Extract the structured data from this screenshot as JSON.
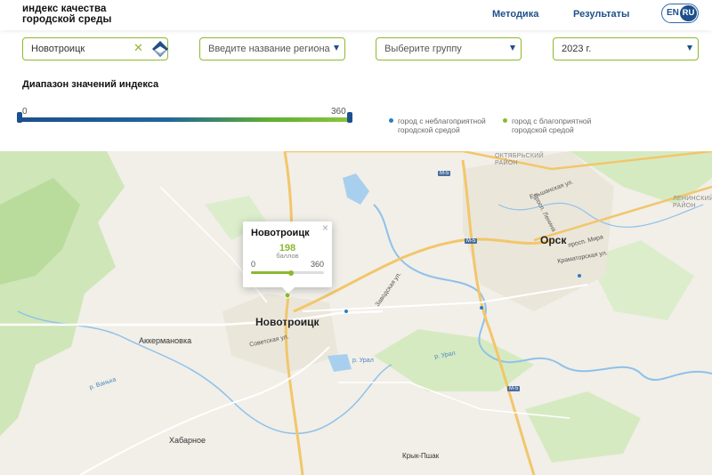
{
  "header": {
    "logo_line1": "индекс качества",
    "logo_line2": "городской среды",
    "nav": [
      "Методика",
      "Результаты"
    ],
    "lang_en": "EN",
    "lang_ru": "RU"
  },
  "filters": {
    "city": {
      "value": "Новотроицк"
    },
    "region": {
      "placeholder": "Введите название региона"
    },
    "group": {
      "placeholder": "Выберите группу"
    },
    "year": {
      "value": "2023 г."
    }
  },
  "range": {
    "title": "Диапазон значений индекса",
    "min": "0",
    "max": "360"
  },
  "legend": [
    {
      "line1": "город с неблагоприятной",
      "line2": "городской средой",
      "color": "#2a7fc1"
    },
    {
      "line1": "город с благоприятной",
      "line2": "городской средой",
      "color": "#8cba2e"
    }
  ],
  "map": {
    "labels": {
      "novotroitsk": "Новотроицк",
      "orsk": "Орск",
      "akkermanovka": "Аккермановка",
      "khabarnoe": "Хабарное",
      "krykpshak": "Крык-Пшак",
      "oktyabrsky": "ОКТЯБРЬСКИЙ\nРАЙОН",
      "leninsky": "ЛЕНИНСКИЙ\nРАЙОН",
      "sovetskaya": "Советская ул.",
      "zavodskaya": "Заводская ул.",
      "prospekt_lenina": "просп. Ленина",
      "prospekt_mira": "просп. Мира",
      "kramatorskaya": "Краматорская ул.",
      "ural1": "р. Урал",
      "ural2": "р. Урал",
      "elshanskaya": "Ельшанская ул.",
      "vanka": "р. Ванька",
      "m5a": "М-5",
      "m5b": "М-5",
      "m5c": "М-5"
    }
  },
  "popup": {
    "title": "Новотроицк",
    "score": "198",
    "unit": "баллов",
    "min": "0",
    "max": "360",
    "score_fraction": 0.55
  }
}
